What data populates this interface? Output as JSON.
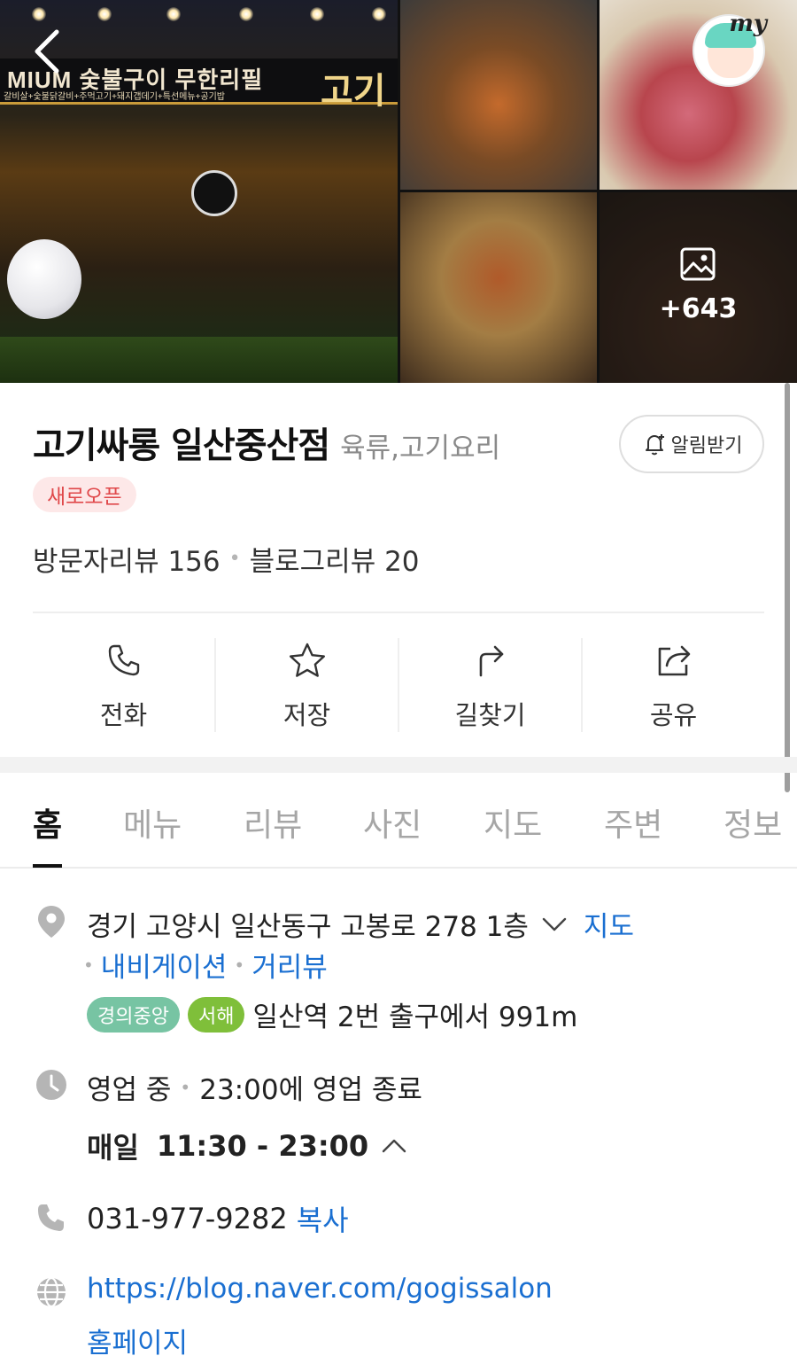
{
  "gallery": {
    "sign_text": "MIUM 숯불구이 무한리필",
    "sign_sub": "갈비살+숯불닭갈비+주먹고기+돼지갭데기+특선메뉴+공기밥",
    "sign_logo": "고기",
    "more_count": "+643",
    "avatar_tag": "my"
  },
  "place": {
    "name": "고기싸롱 일산중산점",
    "category": "육류,고기요리",
    "alarm_label": "알림받기",
    "badge": "새로오픈",
    "visitor_reviews": "방문자리뷰 156",
    "blog_reviews": "블로그리뷰 20"
  },
  "actions": [
    {
      "label": "전화",
      "icon": "phone-icon"
    },
    {
      "label": "저장",
      "icon": "star-icon"
    },
    {
      "label": "길찾기",
      "icon": "directions-icon"
    },
    {
      "label": "공유",
      "icon": "share-icon"
    }
  ],
  "tabs": [
    "홈",
    "메뉴",
    "리뷰",
    "사진",
    "지도",
    "주변",
    "정보"
  ],
  "info": {
    "address": "경기 고양시 일산동구 고봉로 278 1층",
    "map_link": "지도",
    "navi_link": "내비게이션",
    "street_link": "거리뷰",
    "line_a": "경의중앙",
    "line_b": "서해",
    "station": "일산역 2번 출구에서 991m",
    "status": "영업 중",
    "status_detail": "23:00에 영업 종료",
    "day": "매일",
    "hours": "11:30 - 23:00",
    "phone": "031-977-9282",
    "copy": "복사",
    "website": "https://blog.naver.com/gogissalon",
    "homepage": "홈페이지"
  },
  "colors": {
    "link": "#1a6fd1",
    "badge_new_bg": "#fde8e8",
    "badge_new_text": "#e0484a",
    "line_a": "#77c4a3",
    "line_b": "#7fbf3a"
  }
}
